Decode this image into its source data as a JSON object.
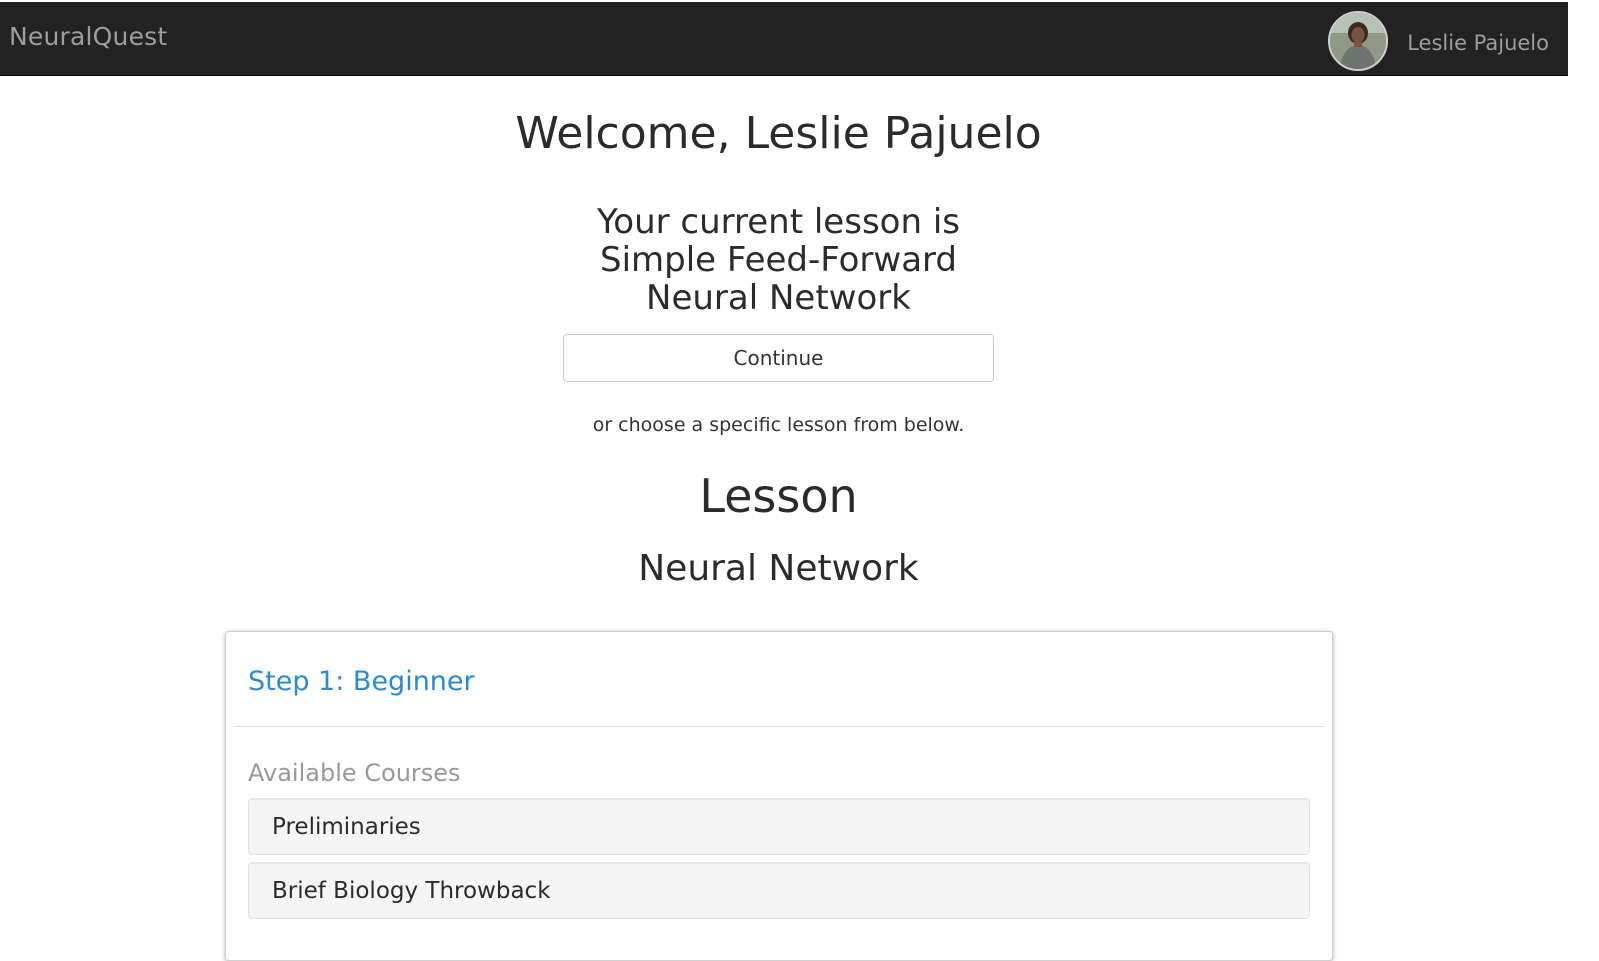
{
  "navbar": {
    "brand": "NeuralQuest",
    "user_name": "Leslie Pajuelo",
    "avatar_icon": "user-avatar-photo"
  },
  "main": {
    "welcome": "Welcome, Leslie Pajuelo",
    "current_lesson_text": "Your current lesson is Simple Feed-Forward Neural Network",
    "continue_label": "Continue",
    "choose_text": "or choose a specific lesson from below.",
    "lesson_heading": "Lesson",
    "lesson_name": "Neural Network"
  },
  "step": {
    "title": "Step 1: Beginner",
    "available_label": "Available Courses",
    "courses": [
      {
        "label": "Preliminaries"
      },
      {
        "label": "Brief Biology Throwback"
      }
    ]
  },
  "colors": {
    "navbar_bg": "#222222",
    "navbar_text": "#9d9d9d",
    "link_blue": "#2a8ad6",
    "muted_text": "#999999",
    "course_bg": "#f5f5f5"
  }
}
